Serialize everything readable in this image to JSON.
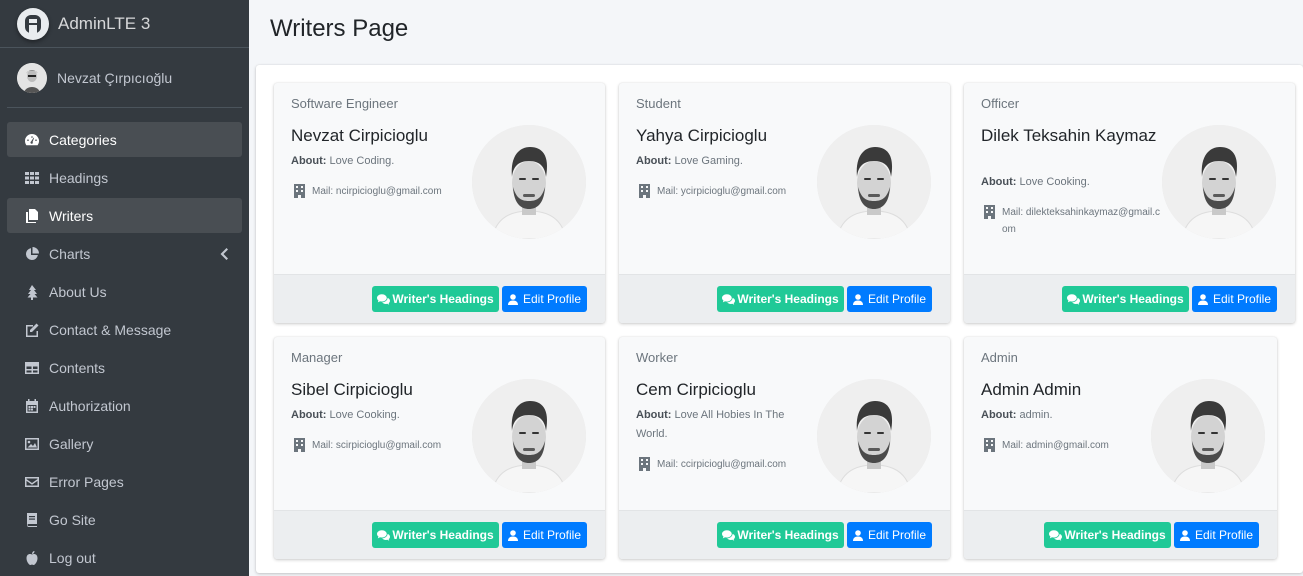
{
  "brand": {
    "name": "AdminLTE 3"
  },
  "user": {
    "name": "Nevzat Çırpıcıoğlu"
  },
  "nav": [
    {
      "label": "Categories",
      "icon": "tachometer-icon",
      "active": true
    },
    {
      "label": "Headings",
      "icon": "grid-icon",
      "active": false
    },
    {
      "label": "Writers",
      "icon": "copy-icon",
      "active": true
    },
    {
      "label": "Charts",
      "icon": "pie-chart-icon",
      "active": false
    },
    {
      "label": "About Us",
      "icon": "tree-icon",
      "active": false
    },
    {
      "label": "Contact & Message",
      "icon": "edit-icon",
      "active": false
    },
    {
      "label": "Contents",
      "icon": "table-icon",
      "active": false
    },
    {
      "label": "Authorization",
      "icon": "calendar-icon",
      "active": false
    },
    {
      "label": "Gallery",
      "icon": "image-icon",
      "active": false
    },
    {
      "label": "Error Pages",
      "icon": "envelope-icon",
      "active": false
    },
    {
      "label": "Go Site",
      "icon": "book-icon",
      "active": false
    },
    {
      "label": "Log out",
      "icon": "apple-icon",
      "active": false
    }
  ],
  "page": {
    "title": "Writers Page"
  },
  "about_label": "About:",
  "mail_label": "Mail:",
  "headings_button": "Writer's Headings",
  "edit_button": "Edit Profile",
  "writers": [
    {
      "job": "Software Engineer",
      "name": "Nevzat Cirpicioglu",
      "about": "Love Coding.",
      "mail": "ncirpicioglu@gmail.com"
    },
    {
      "job": "Student",
      "name": "Yahya Cirpicioglu",
      "about": "Love Gaming.",
      "mail": "ycirpicioglu@gmail.com"
    },
    {
      "job": "Officer",
      "name": "Dilek Teksahin Kaymaz",
      "about": "Love Cooking.",
      "mail": "dilekteksahinkaymaz@gmail.com"
    },
    {
      "job": "Manager",
      "name": "Sibel Cirpicioglu",
      "about": "Love Cooking.",
      "mail": "scirpicioglu@gmail.com"
    },
    {
      "job": "Worker",
      "name": "Cem Cirpicioglu",
      "about": "Love All Hobies In The World.",
      "mail": "ccirpicioglu@gmail.com"
    },
    {
      "job": "Admin",
      "name": "Admin Admin",
      "about": "admin.",
      "mail": "admin@gmail.com"
    }
  ],
  "colors": {
    "sidebar": "#343a40",
    "teal": "#20c997",
    "blue": "#007bff"
  }
}
